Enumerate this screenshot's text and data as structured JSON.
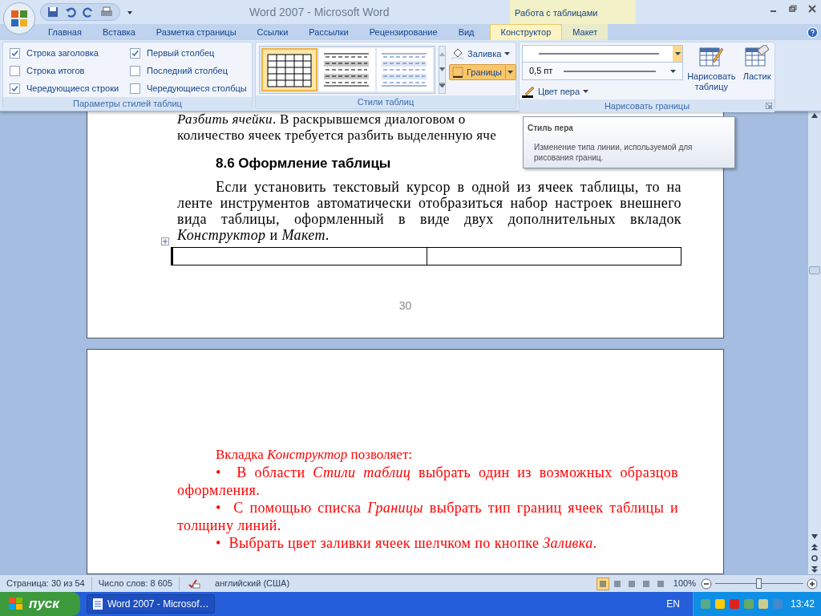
{
  "window": {
    "title": "Word 2007  -  Microsoft Word",
    "context_group": "Работа с таблицами"
  },
  "tabs": [
    {
      "label": "Главная",
      "selected": false,
      "contextual": false
    },
    {
      "label": "Вставка",
      "selected": false,
      "contextual": false
    },
    {
      "label": "Разметка страницы",
      "selected": false,
      "contextual": false
    },
    {
      "label": "Ссылки",
      "selected": false,
      "contextual": false
    },
    {
      "label": "Рассылки",
      "selected": false,
      "contextual": false
    },
    {
      "label": "Рецензирование",
      "selected": false,
      "contextual": false
    },
    {
      "label": "Вид",
      "selected": false,
      "contextual": false
    },
    {
      "label": "Конструктор",
      "selected": true,
      "contextual": true
    },
    {
      "label": "Макет",
      "selected": false,
      "contextual": true
    }
  ],
  "ribbon": {
    "style_options": {
      "label": "Параметры стилей таблиц",
      "checkboxes": [
        {
          "label": "Строка заголовка",
          "checked": true
        },
        {
          "label": "Строка итогов",
          "checked": false
        },
        {
          "label": "Чередующиеся строки",
          "checked": true
        },
        {
          "label": "Первый столбец",
          "checked": true
        },
        {
          "label": "Последний столбец",
          "checked": false
        },
        {
          "label": "Чередующиеся столбцы",
          "checked": false
        }
      ]
    },
    "table_styles": {
      "label": "Стили таблиц",
      "fill": "Заливка",
      "borders": "Границы"
    },
    "draw_borders": {
      "label": "Нарисовать границы",
      "pen_weight": "0,5 пт",
      "pen_color": "Цвет пера",
      "draw_table": "Нарисовать таблицу",
      "eraser": "Ластик"
    }
  },
  "tooltip": {
    "title": "Стиль пера",
    "text": "Изменение типа линии, используемой для рисования границ."
  },
  "page1": {
    "lines": [
      "*Разбить ячейки*. В раскрывшемся диалоговом о",
      "количество ячеек требуется разбить выделенную яче"
    ],
    "heading": "8.6 Оформление таблицы",
    "paragraph": "Если установить текстовый курсор в одной из ячеек таблицы, то на ленте инструментов автоматически отобразиться набор настроек внешнего вида таблицы, оформленный в виде двух дополнительных вкладок *Конструктор* и *Макет*.",
    "page_number": "30"
  },
  "page2": {
    "intro": "Вкладка *Конструктор* позволяет:",
    "bullets": [
      {
        "marker": "•",
        "text": "В области *Стили таблиц* выбрать один из возможных образцов оформления."
      },
      {
        "marker": "•",
        "text": "С помощью списка *Границы* выбрать тип  границ ячеек таблицы и толщину линий."
      },
      {
        "marker": "•",
        "text": "Выбрать цвет заливки ячеек шелчком по кнопке *Заливка*."
      }
    ]
  },
  "status_bar": {
    "page": "Страница: 30 из 54",
    "words": "Число слов: 8 605",
    "language": "английский (США)",
    "zoom": "100%",
    "zoom_slider": {
      "level": 0.5
    }
  },
  "taskbar": {
    "start": "пуск",
    "task": "Word 2007 - Microsof…",
    "lang": "EN",
    "time": "13:42"
  }
}
